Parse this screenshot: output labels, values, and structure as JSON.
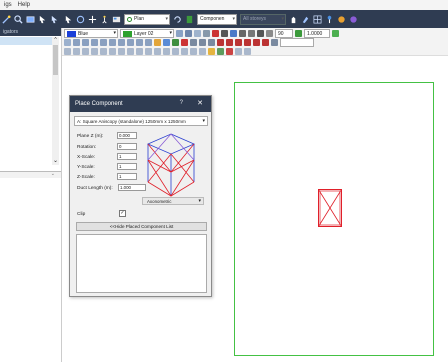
{
  "menubar": {
    "items": [
      "igs",
      "Help"
    ]
  },
  "left_panel": {
    "header": "igators"
  },
  "toolbar": {
    "view_combo": "Plan",
    "component_combo": "Componen",
    "search_combo": "All storeys",
    "angle_value": "90",
    "scale_value": "1.0000"
  },
  "strip": {
    "pen_color": "Blue",
    "layer": "Layer 02"
  },
  "dialog": {
    "title": "Place Component",
    "help": "?",
    "close": "✕",
    "component": "A: Square Aniscopy (standalone) 1250mm x 1250mm",
    "fields": [
      {
        "label": "Plane Z (m):",
        "value": "0.000"
      },
      {
        "label": "Rotation:",
        "value": "0"
      },
      {
        "label": "X-Scale:",
        "value": "1"
      },
      {
        "label": "Y-Scale:",
        "value": "1"
      },
      {
        "label": "Z-Scale:",
        "value": "1"
      }
    ],
    "duct_label": "Duct Length (m):",
    "duct_value": "1.000",
    "view_mode": "Axonometric",
    "clip_label": "Clip",
    "clip_checked": "✓",
    "hide_button": "<<Hide Placed Component List"
  },
  "colors": {
    "toolbar_bg": "#2f3c52",
    "sheet_border": "#44c144",
    "component_red": "#e0202a"
  }
}
